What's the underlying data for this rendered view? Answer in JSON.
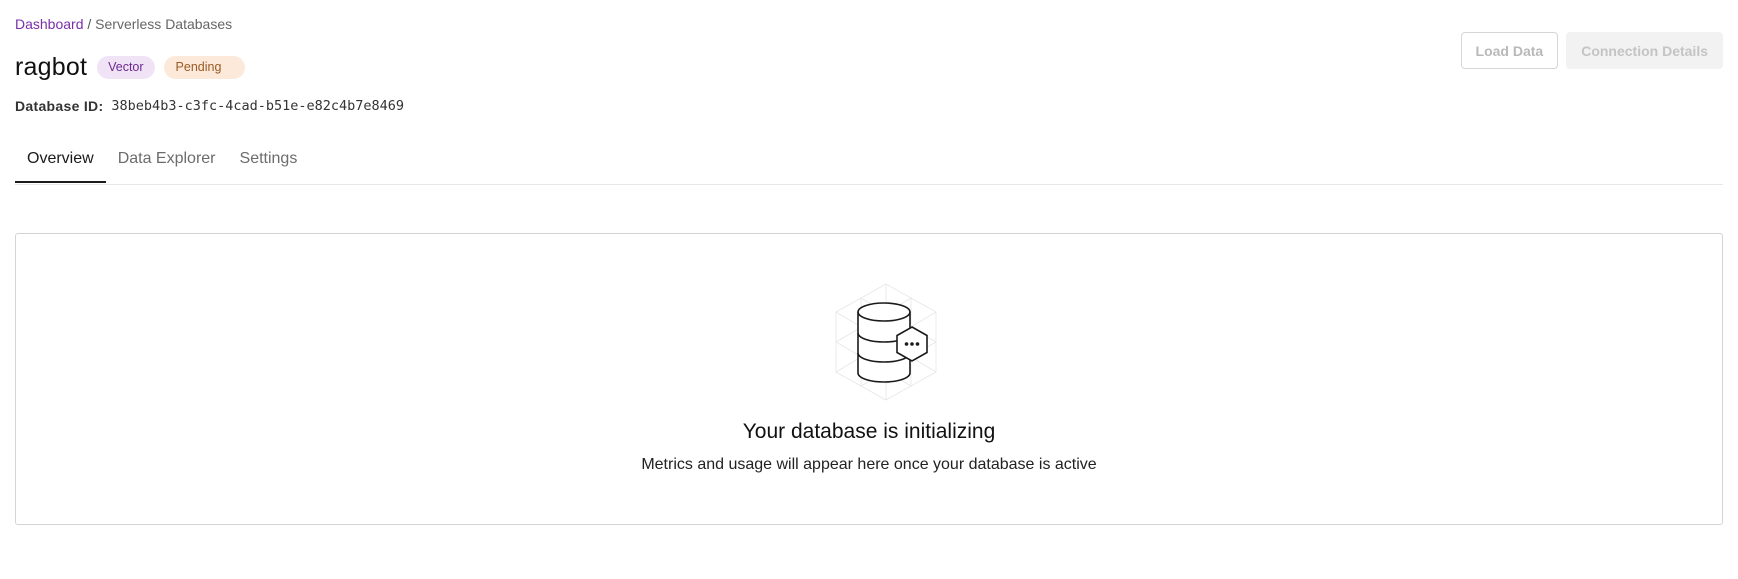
{
  "breadcrumb": {
    "root": "Dashboard",
    "separator": "/",
    "current": "Serverless Databases"
  },
  "database": {
    "name": "ragbot",
    "type_badge": "Vector",
    "status_badge": "Pending",
    "id_label": "Database ID:",
    "id_value": "38beb4b3-c3fc-4cad-b51e-e82c4b7e8469"
  },
  "actions": {
    "load_data": "Load Data",
    "connection_details": "Connection Details"
  },
  "tabs": [
    {
      "label": "Overview",
      "active": true
    },
    {
      "label": "Data Explorer",
      "active": false
    },
    {
      "label": "Settings",
      "active": false
    }
  ],
  "empty_state": {
    "icon": "database-initializing-icon",
    "title": "Your database is initializing",
    "subtitle": "Metrics and usage will appear here once your database is active"
  },
  "colors": {
    "brand_link": "#7b2fa8",
    "vector_badge_bg": "#f1e3f6",
    "pending_badge_bg": "#fce9d9"
  }
}
